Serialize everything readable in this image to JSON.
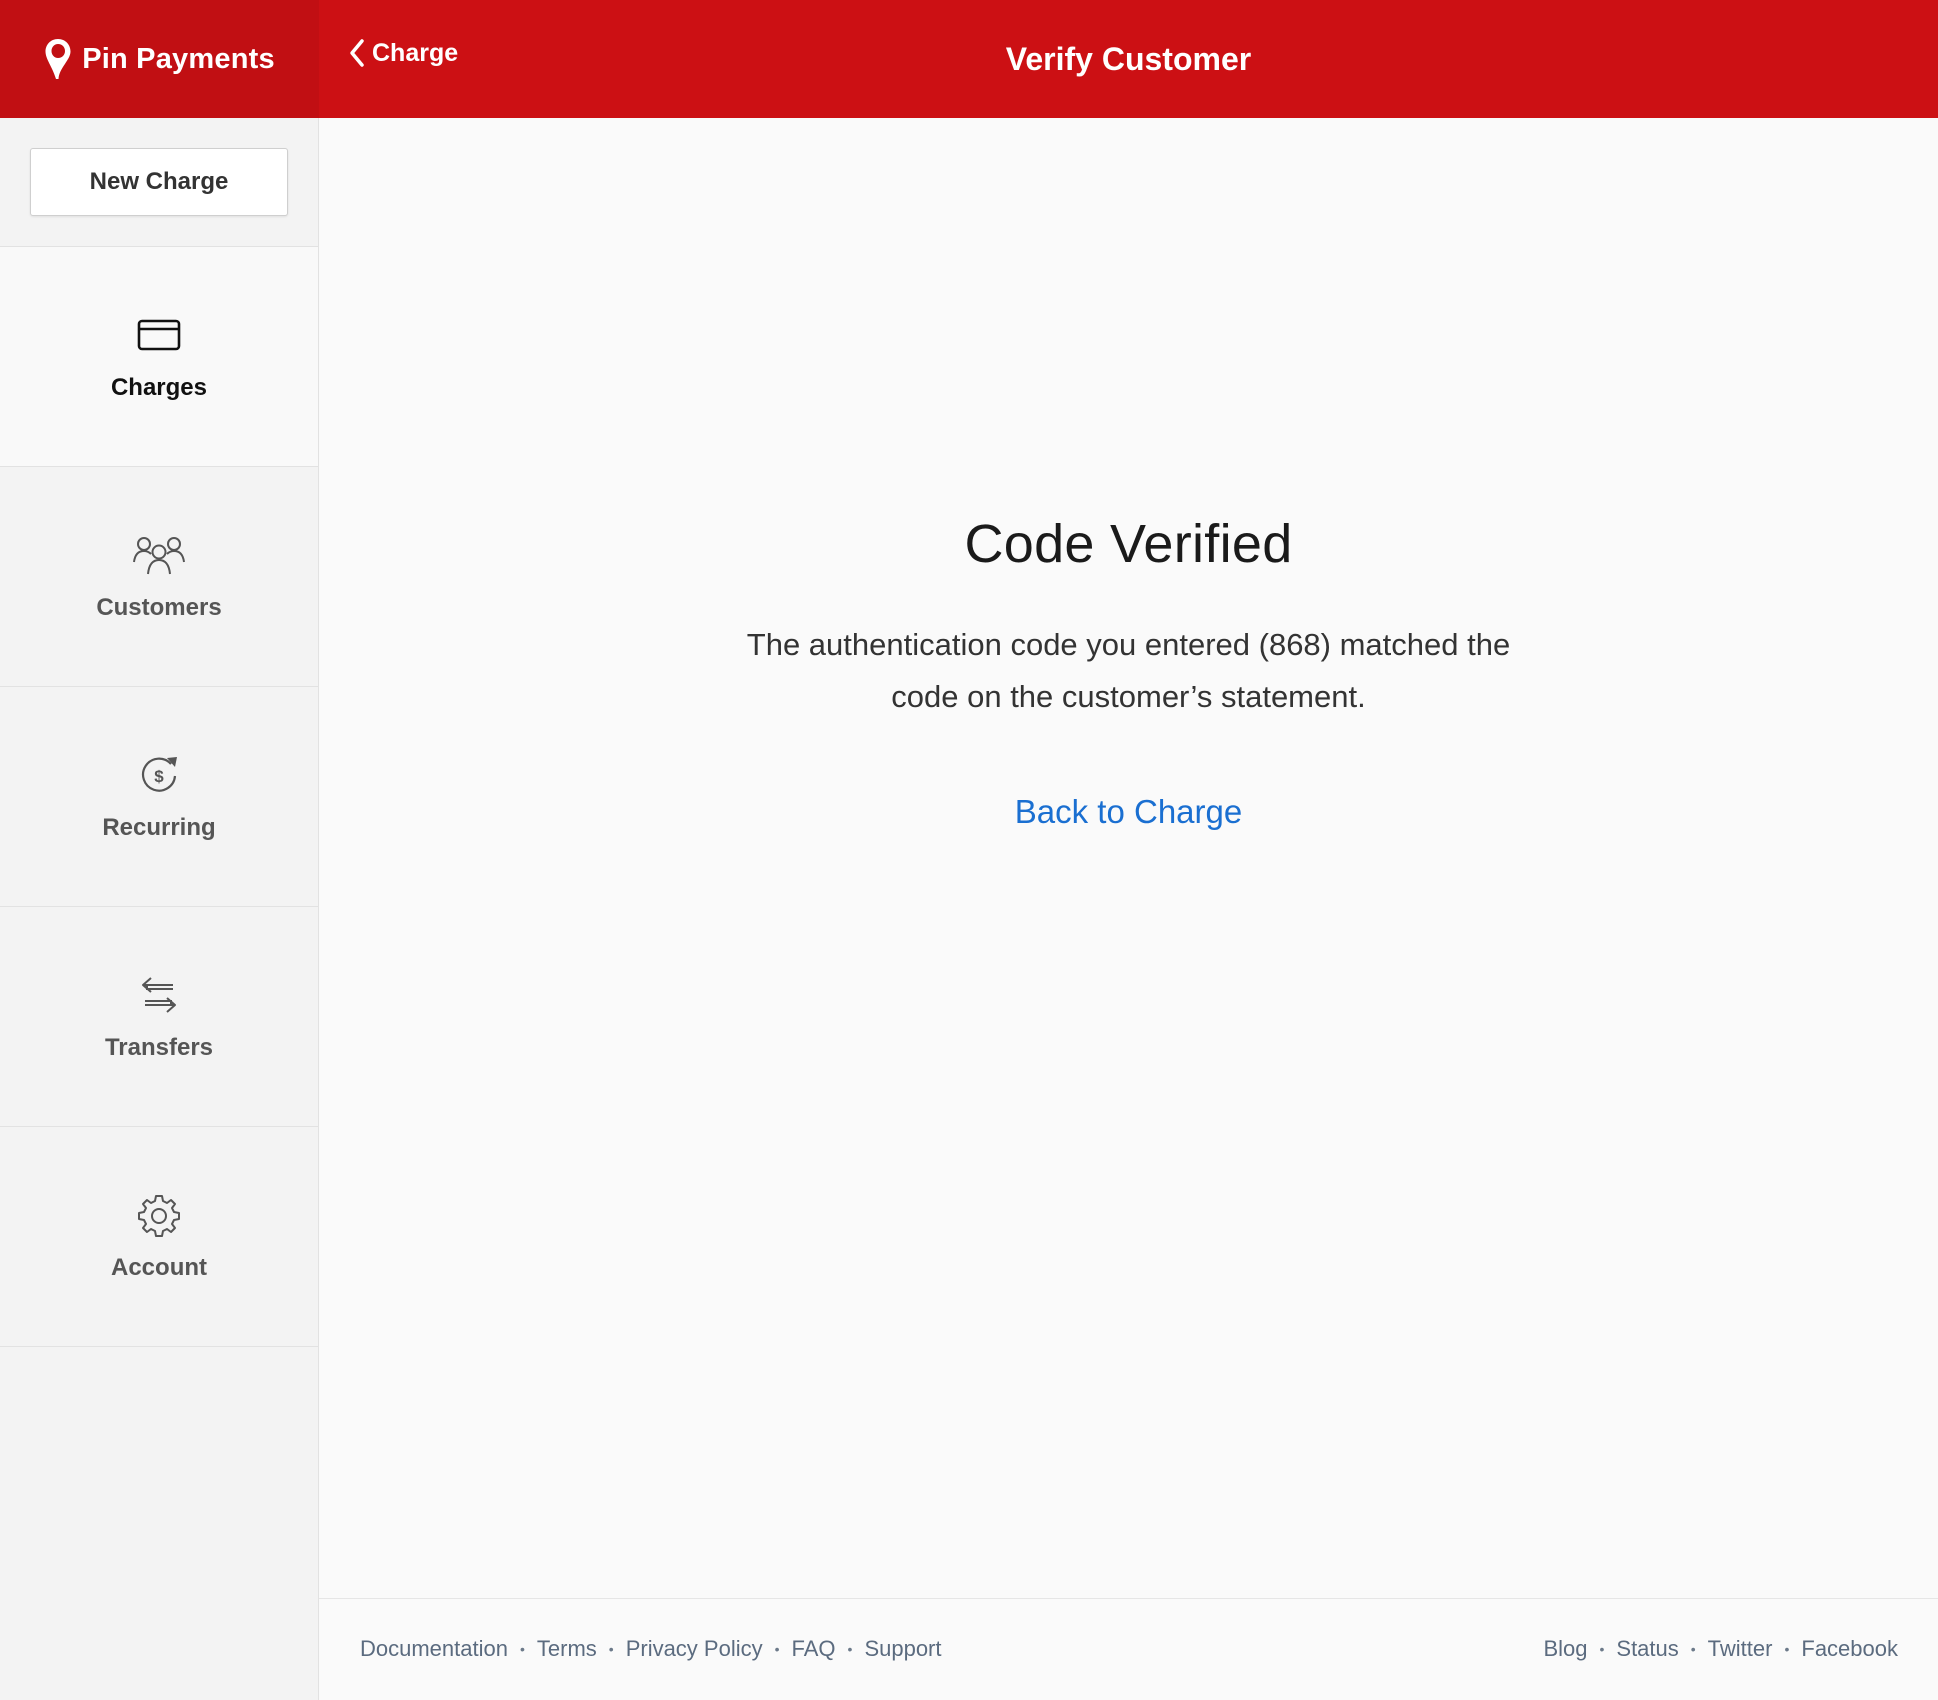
{
  "header": {
    "brand_name": "Pin Payments",
    "back_label": "Charge",
    "title": "Verify Customer",
    "color": "#cc1014"
  },
  "sidebar": {
    "new_charge_label": "New Charge",
    "items": [
      {
        "label": "Charges",
        "icon": "credit-card-icon",
        "active": true
      },
      {
        "label": "Customers",
        "icon": "users-icon",
        "active": false
      },
      {
        "label": "Recurring",
        "icon": "recurring-dollar-icon",
        "active": false
      },
      {
        "label": "Transfers",
        "icon": "transfer-arrows-icon",
        "active": false
      },
      {
        "label": "Account",
        "icon": "gear-icon",
        "active": false
      }
    ]
  },
  "main": {
    "heading": "Code Verified",
    "message": "The authentication code you entered (868) matched the code on the customer’s statement.",
    "back_link": "Back to Charge",
    "link_color": "#1a6fd1"
  },
  "footer": {
    "left_links": [
      "Documentation",
      "Terms",
      "Privacy Policy",
      "FAQ",
      "Support"
    ],
    "right_links": [
      "Blog",
      "Status",
      "Twitter",
      "Facebook"
    ],
    "separator": "•"
  }
}
